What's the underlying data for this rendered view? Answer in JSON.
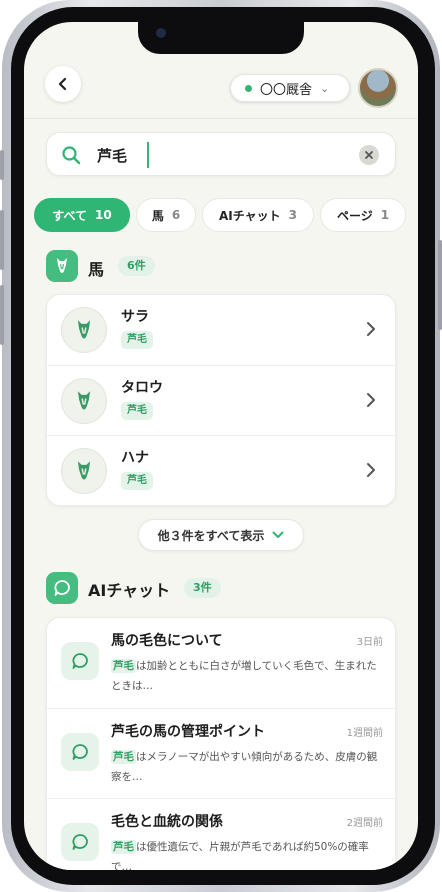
{
  "header": {
    "stable_name": "〇〇厩舎"
  },
  "search": {
    "query": "芦毛"
  },
  "tabs": [
    {
      "label": "すべて",
      "count": "10"
    },
    {
      "label": "馬",
      "count": "6"
    },
    {
      "label": "AIチャット",
      "count": "3"
    },
    {
      "label": "ページ",
      "count": "1"
    }
  ],
  "horses": {
    "title": "馬",
    "count": "6件",
    "items": [
      {
        "name": "サラ",
        "tag": "芦毛"
      },
      {
        "name": "タロウ",
        "tag": "芦毛"
      },
      {
        "name": "ハナ",
        "tag": "芦毛"
      }
    ],
    "more_label": "他３件をすべて表示"
  },
  "chats": {
    "title": "AIチャット",
    "count": "3件",
    "items": [
      {
        "title": "馬の毛色について",
        "time": "3日前",
        "highlight": "芦毛",
        "rest": "は加齢とともに白さが増していく毛色で、生まれたときは…"
      },
      {
        "title": "芦毛の馬の管理ポイント",
        "time": "1週間前",
        "highlight": "芦毛",
        "rest": "はメラノーマが出やすい傾向があるため、皮膚の観察を…"
      },
      {
        "title": "毛色と血統の関係",
        "time": "2週間前",
        "highlight": "芦毛",
        "rest": "は優性遺伝で、片親が芦毛であれば約50%の確率で…"
      }
    ]
  },
  "colors": {
    "accent": "#2fb574",
    "section_icon": "#45bd80",
    "tag_bg": "#e3f3e9",
    "background": "#f6f6f1"
  },
  "icons": {
    "back": "chevron-left-icon",
    "search": "search-icon",
    "clear": "close-icon",
    "horse": "horse-head-icon",
    "chat": "chat-bubble-icon",
    "row": "chevron-right-icon",
    "more": "chevron-down-icon"
  }
}
